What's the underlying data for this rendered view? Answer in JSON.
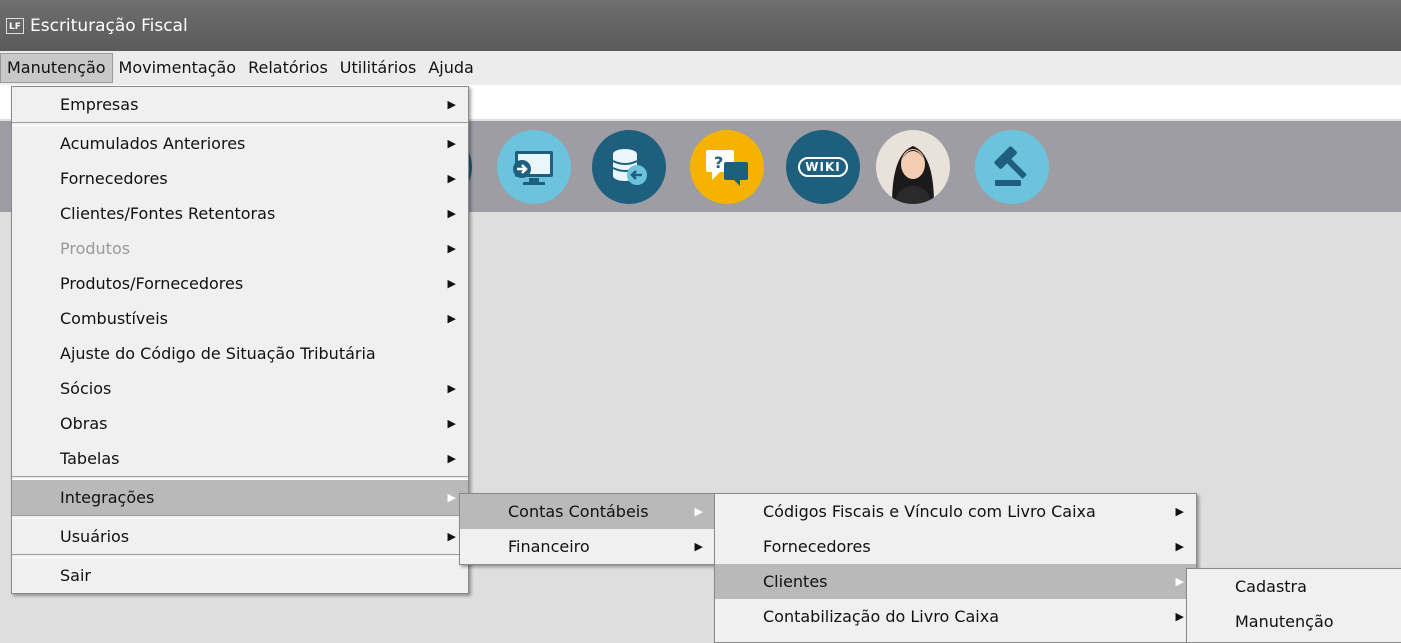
{
  "window": {
    "title": "Escrituração Fiscal",
    "icon_text": "LF"
  },
  "menubar": [
    "Manutenção",
    "Movimentação",
    "Relatórios",
    "Utilitários",
    "Ajuda"
  ],
  "menu1": {
    "items": [
      {
        "label": "Empresas"
      },
      {
        "label": "Acumulados Anteriores"
      },
      {
        "label": "Fornecedores"
      },
      {
        "label": "Clientes/Fontes Retentoras"
      },
      {
        "label": "Produtos"
      },
      {
        "label": "Produtos/Fornecedores"
      },
      {
        "label": "Combustíveis"
      },
      {
        "label": "Ajuste do Código de Situação Tributária"
      },
      {
        "label": "Sócios"
      },
      {
        "label": "Obras"
      },
      {
        "label": "Tabelas"
      },
      {
        "label": "Integrações"
      },
      {
        "label": "Usuários"
      },
      {
        "label": "Sair"
      }
    ]
  },
  "menu2": {
    "items": [
      {
        "label": "Contas Contábeis"
      },
      {
        "label": "Financeiro"
      }
    ]
  },
  "menu3": {
    "items": [
      {
        "label": "Códigos Fiscais e Vínculo com Livro Caixa"
      },
      {
        "label": "Fornecedores"
      },
      {
        "label": "Clientes"
      },
      {
        "label": "Contabilização do Livro Caixa"
      }
    ]
  },
  "menu4": {
    "items": [
      {
        "label": "Cadastra"
      },
      {
        "label": "Manutenção"
      }
    ]
  },
  "toolbar": {
    "wiki_label": "WIKI",
    "help_label": "?"
  },
  "colors": {
    "titlebar": "#5f5f5f",
    "toolbar": "#9e9da3",
    "highlight": "#b9b9b9"
  },
  "icons": [
    "monitor-transfer-icon",
    "database-transfer-icon",
    "chat-help-icon",
    "wiki-icon",
    "assistant-avatar-icon",
    "gavel-icon"
  ]
}
